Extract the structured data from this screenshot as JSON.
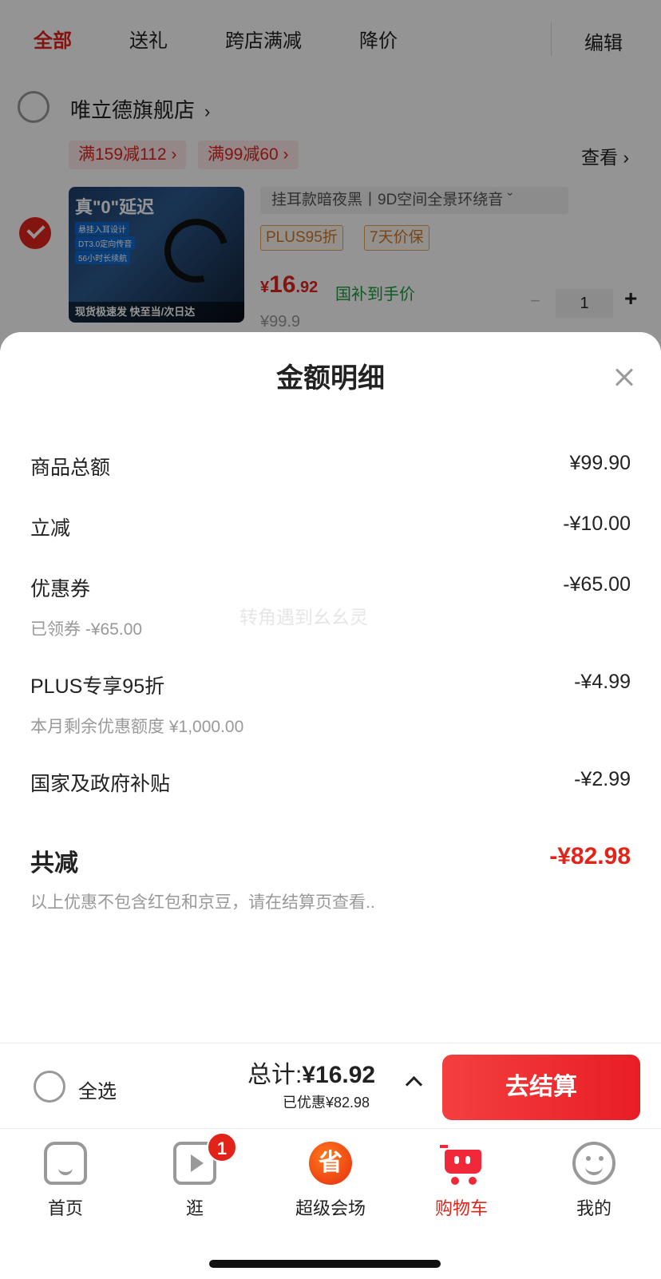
{
  "tabs": [
    "全部",
    "送礼",
    "跨店满减",
    "降价"
  ],
  "edit_label": "编辑",
  "shop": {
    "name": "唯立德旗舰店",
    "promos": [
      "满159减112 ›",
      "满99减60 ›"
    ],
    "view_label": "查看 ›"
  },
  "product": {
    "image_headline": "真\"0\"延迟",
    "image_features": [
      "悬挂入耳设计",
      "DT3.0定向传音",
      "56小时长续航"
    ],
    "image_strip": "现货极速发  快至当/次日达",
    "variant": "挂耳款暗夜黑丨9D空间全景环绕音  ˇ",
    "tags": [
      "PLUS95折",
      "7天价保"
    ],
    "price_symbol": "¥",
    "price_int": "16",
    "price_dec": ".92",
    "price_note": "国补到手价",
    "original_price": "¥99.9",
    "quantity": "1"
  },
  "sheet": {
    "title": "金额明细",
    "watermark": "转角遇到幺幺灵",
    "rows": [
      {
        "label": "商品总额",
        "value": "¥99.90",
        "sub": ""
      },
      {
        "label": "立减",
        "value": "-¥10.00",
        "sub": ""
      },
      {
        "label": "优惠券",
        "value": "-¥65.00",
        "sub": "已领券 -¥65.00"
      },
      {
        "label": "PLUS专享95折",
        "value": "-¥4.99",
        "sub": "本月剩余优惠额度 ¥1,000.00"
      },
      {
        "label": "国家及政府补贴",
        "value": "-¥2.99",
        "sub": ""
      }
    ],
    "total_label": "共减",
    "total_value": "-¥82.98",
    "footnote": "以上优惠不包含红包和京豆，请在结算页查看.."
  },
  "checkout": {
    "select_all": "全选",
    "sum_prefix": "总计:",
    "sum_value": "¥16.92",
    "saved": "已优惠¥82.98",
    "button": "去结算"
  },
  "nav": {
    "items": [
      {
        "label": "首页",
        "icon": "home-icon"
      },
      {
        "label": "逛",
        "icon": "video-icon",
        "badge": "1"
      },
      {
        "label": "超级会场",
        "icon": "super-venue-icon",
        "glyph": "省"
      },
      {
        "label": "购物车",
        "icon": "cart-icon"
      },
      {
        "label": "我的",
        "icon": "profile-icon"
      }
    ]
  },
  "colors": {
    "accent": "#e2231a",
    "green_note": "#1a9c3d",
    "tag_orange": "#d1782a"
  }
}
